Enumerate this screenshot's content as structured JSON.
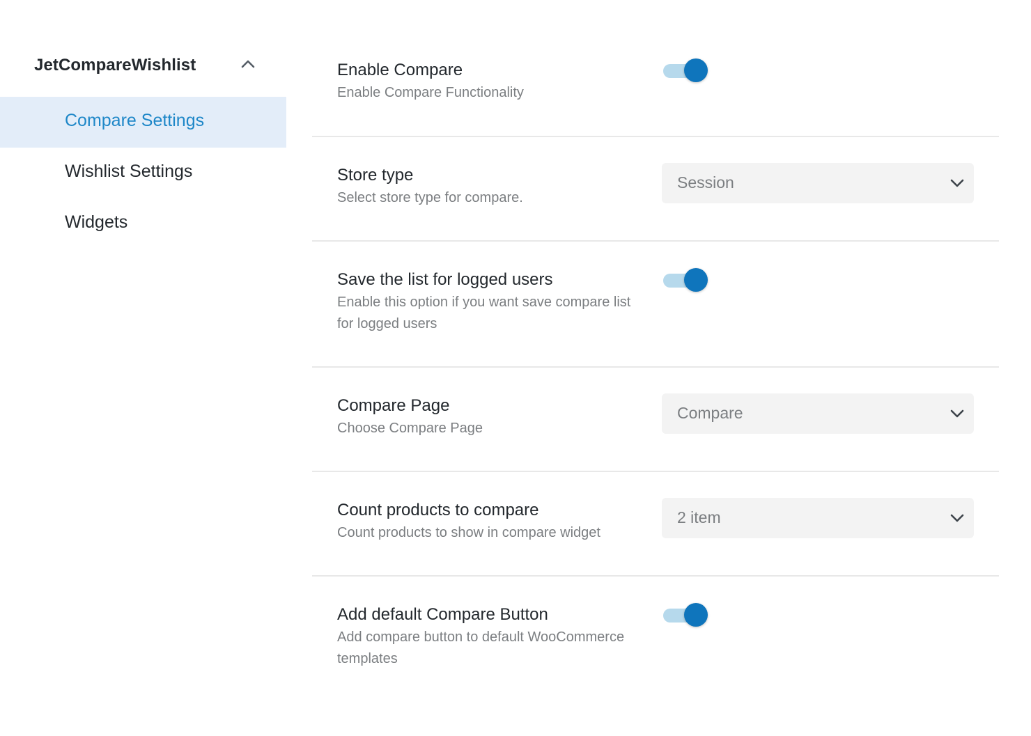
{
  "sidebar": {
    "plugin_title": "JetCompareWishlist",
    "items": [
      {
        "label": "Compare Settings",
        "active": true
      },
      {
        "label": "Wishlist Settings",
        "active": false
      },
      {
        "label": "Widgets",
        "active": false
      }
    ]
  },
  "settings": {
    "enable_compare": {
      "title": "Enable Compare",
      "description": "Enable Compare Functionality",
      "enabled": true
    },
    "store_type": {
      "title": "Store type",
      "description": "Select store type for compare.",
      "selected": "Session"
    },
    "save_list": {
      "title": "Save the list for logged users",
      "description": "Enable this option if you want save compare list for logged users",
      "enabled": true
    },
    "compare_page": {
      "title": "Compare Page",
      "description": "Choose Compare Page",
      "selected": "Compare"
    },
    "count_products": {
      "title": "Count products to compare",
      "description": "Count products to show in compare widget",
      "selected": "2 item"
    },
    "default_button": {
      "title": "Add default Compare Button",
      "description": "Add compare button to default WooCommerce templates",
      "enabled": true
    }
  },
  "colors": {
    "accent": "#0f75bc",
    "toggle_track": "#b6d9ec",
    "active_nav_bg": "#e3edf9",
    "active_nav_text": "#1e87c8",
    "select_bg": "#f3f3f3",
    "divider": "#e8e8e8"
  }
}
